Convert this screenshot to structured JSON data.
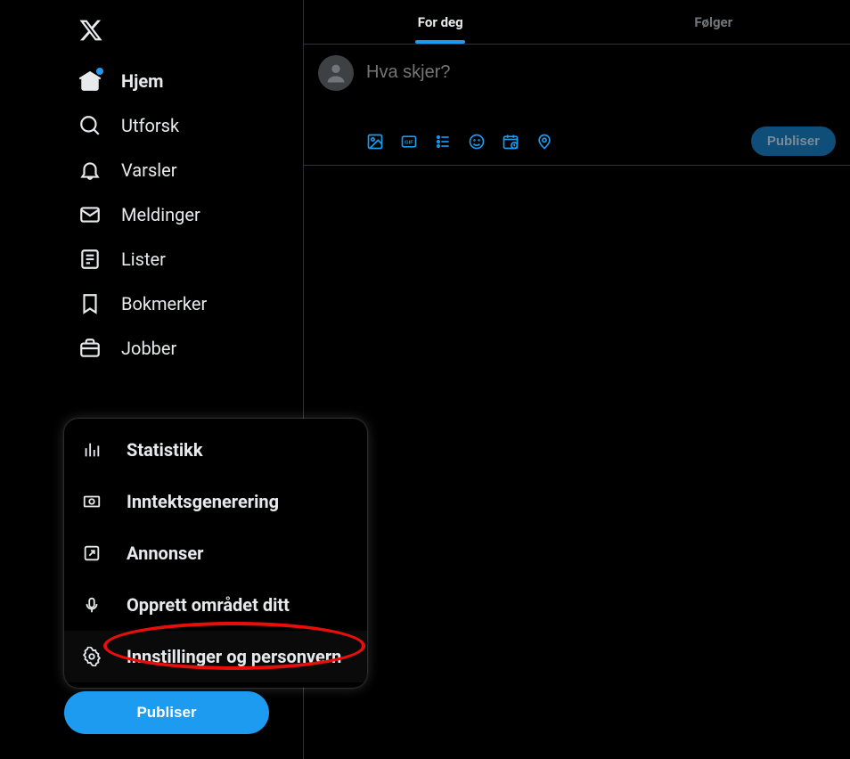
{
  "colors": {
    "accent": "#1d9bf0",
    "fg": "#e7e9ea",
    "bg": "#000000",
    "border": "#2f3336",
    "muted": "#71767b"
  },
  "sidebar": {
    "items": [
      {
        "icon": "home-icon",
        "label": "Hjem",
        "active": true
      },
      {
        "icon": "search-icon",
        "label": "Utforsk"
      },
      {
        "icon": "bell-icon",
        "label": "Varsler"
      },
      {
        "icon": "mail-icon",
        "label": "Meldinger"
      },
      {
        "icon": "list-icon",
        "label": "Lister"
      },
      {
        "icon": "bookmark-icon",
        "label": "Bokmerker"
      },
      {
        "icon": "briefcase-icon",
        "label": "Jobber"
      }
    ],
    "publish_label": "Publiser"
  },
  "more_menu": {
    "items": [
      {
        "icon": "stats-icon",
        "label": "Statistikk"
      },
      {
        "icon": "monetize-icon",
        "label": "Inntektsgenerering"
      },
      {
        "icon": "ads-icon",
        "label": "Annonser"
      },
      {
        "icon": "space-icon",
        "label": "Opprett området ditt"
      },
      {
        "icon": "settings-icon",
        "label": "Innstillinger og personvern"
      }
    ]
  },
  "tabs": [
    {
      "label": "For deg",
      "active": true
    },
    {
      "label": "Følger"
    }
  ],
  "composer": {
    "placeholder": "Hva skjer?",
    "publish_label": "Publiser"
  }
}
